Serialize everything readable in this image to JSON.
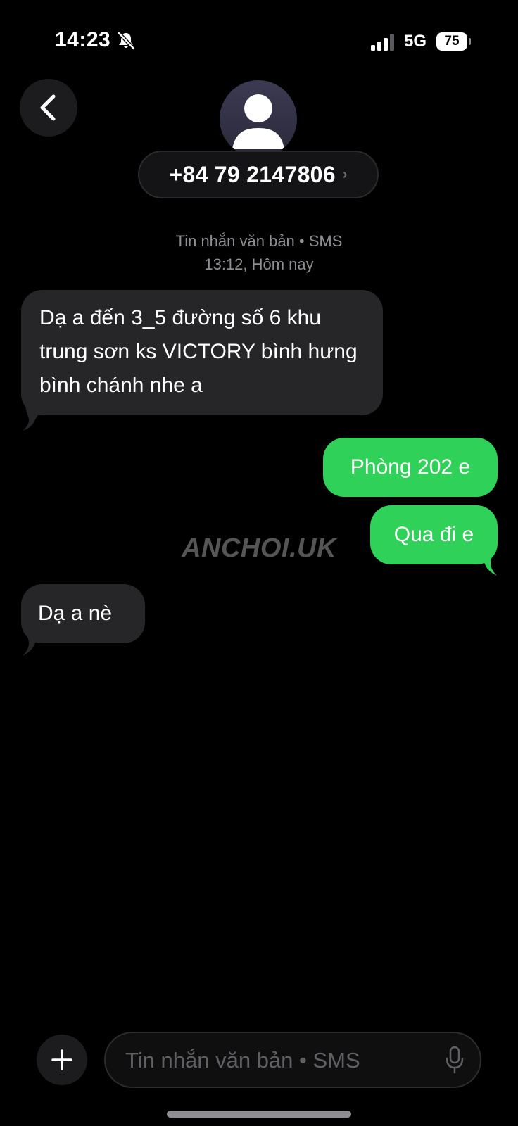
{
  "status_bar": {
    "time": "14:23",
    "network": "5G",
    "battery": "75"
  },
  "header": {
    "contact": "+84 79 2147806",
    "chevron": "›"
  },
  "conversation": {
    "meta_type": "Tin nhắn văn bản • SMS",
    "meta_time": "13:12, Hôm nay",
    "messages": [
      {
        "direction": "incoming",
        "text": "Dạ a đến 3_5 đường số 6 khu trung sơn ks VICTORY bình hưng bình chánh nhe a"
      },
      {
        "direction": "outgoing",
        "text": "Phòng 202 e"
      },
      {
        "direction": "outgoing",
        "text": "Qua đi e"
      },
      {
        "direction": "incoming",
        "text": "Dạ a nè"
      }
    ]
  },
  "watermark": "ANCHOI.UK",
  "composer": {
    "placeholder": "Tin nhắn văn bản • SMS"
  },
  "colors": {
    "background": "#000000",
    "incoming_bubble": "#262628",
    "outgoing_bubble": "#30d158",
    "meta_text": "#8e8e93"
  },
  "icons": [
    "bell-slash-icon",
    "cellular-signal-icon",
    "battery-icon",
    "back-chevron-icon",
    "person-icon",
    "plus-icon",
    "microphone-icon"
  ]
}
